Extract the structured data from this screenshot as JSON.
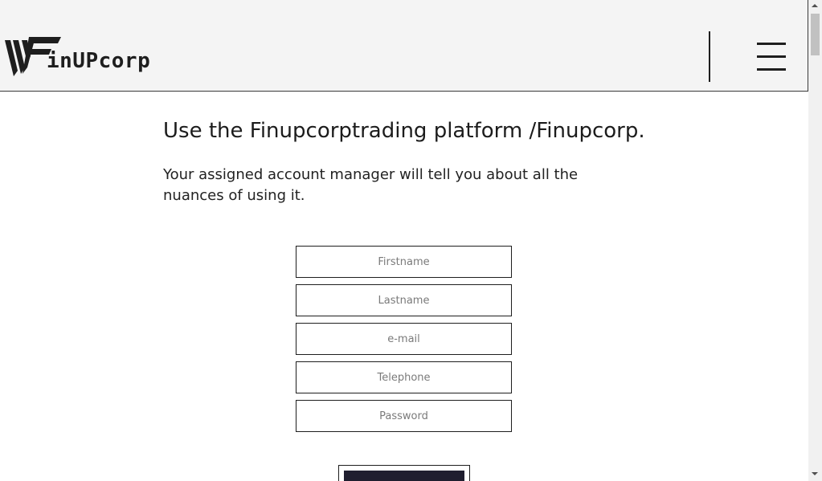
{
  "header": {
    "logo_text": "inUPcorp",
    "menu_icon": "hamburger-icon",
    "logo_mark_icon": "finupcorp-logo-mark"
  },
  "main": {
    "headline": "Use the Finupcorptrading platform /Finupcorp.",
    "subtext": "Your assigned account manager will tell you about all the nuances of using it."
  },
  "form": {
    "firstname_placeholder": "Firstname",
    "lastname_placeholder": "Lastname",
    "email_placeholder": "e-mail",
    "telephone_placeholder": "Telephone",
    "password_placeholder": "Password",
    "submit_label": ""
  },
  "colors": {
    "header_bg": "#f4f4f4",
    "text_dark": "#1e1e1e",
    "button_bg": "#1f1e2f"
  }
}
